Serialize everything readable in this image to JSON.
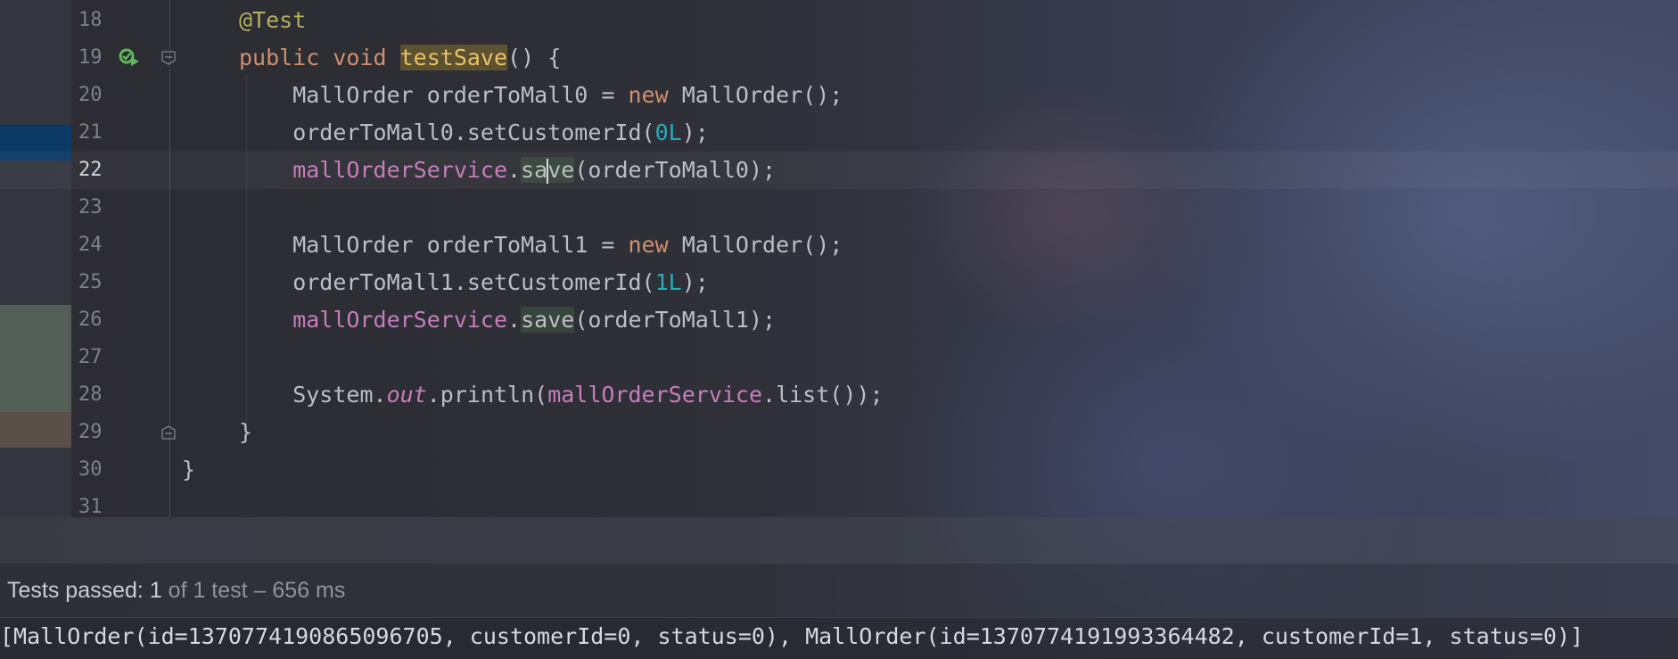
{
  "editor": {
    "lines": [
      {
        "n": "18"
      },
      {
        "n": "19"
      },
      {
        "n": "20"
      },
      {
        "n": "21"
      },
      {
        "n": "22"
      },
      {
        "n": "23"
      },
      {
        "n": "24"
      },
      {
        "n": "25"
      },
      {
        "n": "26"
      },
      {
        "n": "27"
      },
      {
        "n": "28"
      },
      {
        "n": "29"
      },
      {
        "n": "30"
      },
      {
        "n": "31"
      }
    ],
    "tokens": {
      "l18_ann": "@Test",
      "l19_kw": "public void ",
      "l19_method": "testSave",
      "l19_rest": "() {",
      "l20_a": "    MallOrder orderToMall0 = ",
      "l20_kw": "new",
      "l20_b": " MallOrder();",
      "l21_a": "    orderToMall0.setCustomerId(",
      "l21_num": "0L",
      "l21_b": ");",
      "l22_fld": "    mallOrderService",
      "l22_dot": ".",
      "l22_call1": "sa",
      "l22_call2": "ve",
      "l22_b": "(orderToMall0);",
      "l24_a": "    MallOrder orderToMall1 = ",
      "l24_kw": "new",
      "l24_b": " MallOrder();",
      "l25_a": "    orderToMall1.setCustomerId(",
      "l25_num": "1L",
      "l25_b": ");",
      "l26_fld": "    mallOrderService",
      "l26_dot": ".",
      "l26_call": "save",
      "l26_b": "(orderToMall1);",
      "l28_a": "    System.",
      "l28_ital": "out",
      "l28_b": ".println(",
      "l28_fld": "mallOrderService",
      "l28_c": ".list());",
      "l29": "}",
      "l30": "}"
    }
  },
  "status": {
    "label": "Tests passed: ",
    "count": "1",
    "detail": " of 1 test – 656 ms"
  },
  "console": {
    "output": "[MallOrder(id=1370774190865096705, customerId=0, status=0), MallOrder(id=1370774191993364482, customerId=1, status=0)]"
  },
  "colors": {
    "keyword": "#cf8e6d",
    "annotation": "#b3ae60",
    "field": "#c77dbb",
    "number": "#2aacb8",
    "text": "#bcbec4",
    "run_icon": "#5fb85a"
  },
  "icons": {
    "run": "run-test-gutter-icon",
    "fold": "fold-marker-icon"
  }
}
